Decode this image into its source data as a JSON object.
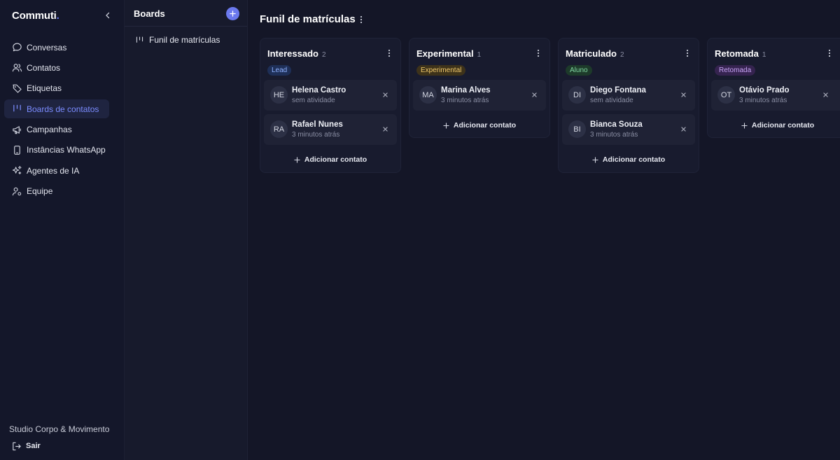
{
  "app": {
    "logo": "Commuti",
    "logo_dot": "."
  },
  "sidebar": {
    "items": [
      {
        "label": "Conversas",
        "icon": "chat-bubble-icon"
      },
      {
        "label": "Contatos",
        "icon": "users-icon"
      },
      {
        "label": "Etiquetas",
        "icon": "tag-icon"
      },
      {
        "label": "Boards de contatos",
        "icon": "kanban-icon",
        "active": true
      },
      {
        "label": "Campanhas",
        "icon": "megaphone-icon"
      },
      {
        "label": "Instâncias WhatsApp",
        "icon": "smartphone-icon"
      },
      {
        "label": "Agentes de IA",
        "icon": "sparkles-icon"
      },
      {
        "label": "Equipe",
        "icon": "user-gear-icon"
      }
    ],
    "org_name": "Studio Corpo & Movimento",
    "logout_label": "Sair"
  },
  "boards_panel": {
    "title": "Boards",
    "items": [
      {
        "label": "Funil de matrículas"
      }
    ]
  },
  "main": {
    "title": "Funil de matrículas",
    "add_contact_label": "Adicionar contato",
    "columns": [
      {
        "title": "Interessado",
        "count": "2",
        "tag": {
          "label": "Lead",
          "bg": "#1e2f57",
          "fg": "#8fb2ff"
        },
        "cards": [
          {
            "initials": "HE",
            "name": "Helena Castro",
            "sub": "sem atividade"
          },
          {
            "initials": "RA",
            "name": "Rafael Nunes",
            "sub": "3 minutos atrás"
          }
        ]
      },
      {
        "title": "Experimental",
        "count": "1",
        "tag": {
          "label": "Experimental",
          "bg": "#3d321a",
          "fg": "#f0c86a"
        },
        "cards": [
          {
            "initials": "MA",
            "name": "Marina Alves",
            "sub": "3 minutos atrás"
          }
        ]
      },
      {
        "title": "Matriculado",
        "count": "2",
        "tag": {
          "label": "Aluno",
          "bg": "#1d3a2a",
          "fg": "#7fd7a0"
        },
        "cards": [
          {
            "initials": "DI",
            "name": "Diego Fontana",
            "sub": "sem atividade"
          },
          {
            "initials": "BI",
            "name": "Bianca Souza",
            "sub": "3 minutos atrás"
          }
        ]
      },
      {
        "title": "Retomada",
        "count": "1",
        "tag": {
          "label": "Retomada",
          "bg": "#35234f",
          "fg": "#c7a3f5"
        },
        "cards": [
          {
            "initials": "OT",
            "name": "Otávio Prado",
            "sub": "3 minutos atrás"
          }
        ]
      }
    ]
  },
  "colors": {
    "accent": "#6b79ee",
    "active_nav_bg": "#1f2440",
    "active_nav_text": "#7b8cff"
  }
}
